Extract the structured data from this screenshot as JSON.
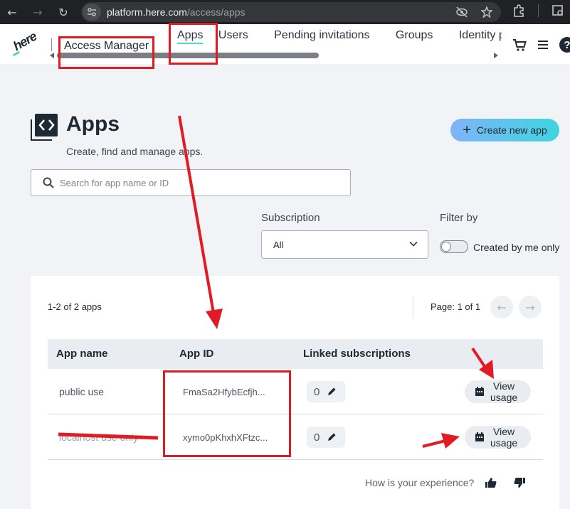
{
  "browser": {
    "url_host": "platform.here.com",
    "url_path": "/access/apps"
  },
  "header": {
    "logo_text": "here",
    "title": "Access Manager",
    "tabs": [
      {
        "label": "Apps"
      },
      {
        "label": "Users"
      },
      {
        "label": "Pending invitations"
      },
      {
        "label": "Groups"
      },
      {
        "label": "Identity p"
      }
    ]
  },
  "page": {
    "title": "Apps",
    "subtitle": "Create, find and manage apps.",
    "create_button": "Create new app",
    "search_placeholder": "Search for app name or ID"
  },
  "filters": {
    "subscription_label": "Subscription",
    "subscription_value": "All",
    "filter_by_label": "Filter by",
    "toggle_label": "Created by me only",
    "toggle_on": false
  },
  "table": {
    "count": "1-2 of 2 apps",
    "page_indicator": "Page: 1 of 1",
    "columns": [
      "App name",
      "App ID",
      "Linked subscriptions"
    ],
    "rows": [
      {
        "name": "public use",
        "app_id": "FmaSa2HfybEcfjh...",
        "linked": "0",
        "action": "View\nusage"
      },
      {
        "name": "localhost use only",
        "app_id": "xymo0pKhxhXFtzc...",
        "linked": "0",
        "action": "View\nusage"
      }
    ]
  },
  "feedback": {
    "question": "How is your experience?"
  },
  "colors": {
    "accent": "#48dad0",
    "annotation_red": "#e01b24"
  }
}
